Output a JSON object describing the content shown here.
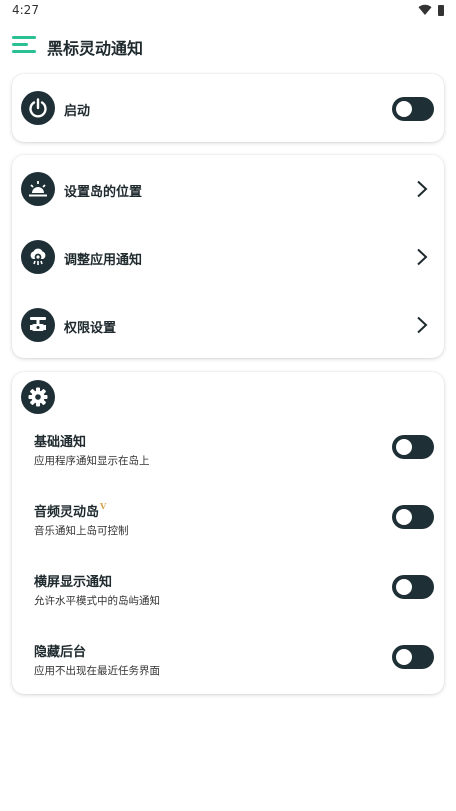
{
  "status_bar": {
    "time": "4:27",
    "icons": [
      "wifi-icon",
      "battery-icon"
    ]
  },
  "app_bar": {
    "title": "黑标灵动通知",
    "menu_icon": "menu-icon"
  },
  "colors": {
    "accent": "#2bbf94",
    "dark": "#1e2f35",
    "vip": "#d4a24a"
  },
  "power_card": {
    "label": "启动",
    "icon": "power-icon",
    "enabled": false
  },
  "nav_card": {
    "items": [
      {
        "label": "设置岛的位置",
        "icon": "sunrise-icon"
      },
      {
        "label": "调整应用通知",
        "icon": "cloud-icon"
      },
      {
        "label": "权限设置",
        "icon": "valve-icon"
      }
    ]
  },
  "settings_card": {
    "icon": "settings-gear-icon",
    "items": [
      {
        "title": "基础通知",
        "desc": "应用程序通知显示在岛上",
        "enabled": false
      },
      {
        "title": "音频灵动岛",
        "badge": "V",
        "desc": "音乐通知上岛可控制",
        "enabled": false
      },
      {
        "title": "横屏显示通知",
        "desc": "允许水平模式中的岛屿通知",
        "enabled": false
      },
      {
        "title": "隐藏后台",
        "desc": "应用不出现在最近任务界面",
        "enabled": false
      }
    ]
  }
}
